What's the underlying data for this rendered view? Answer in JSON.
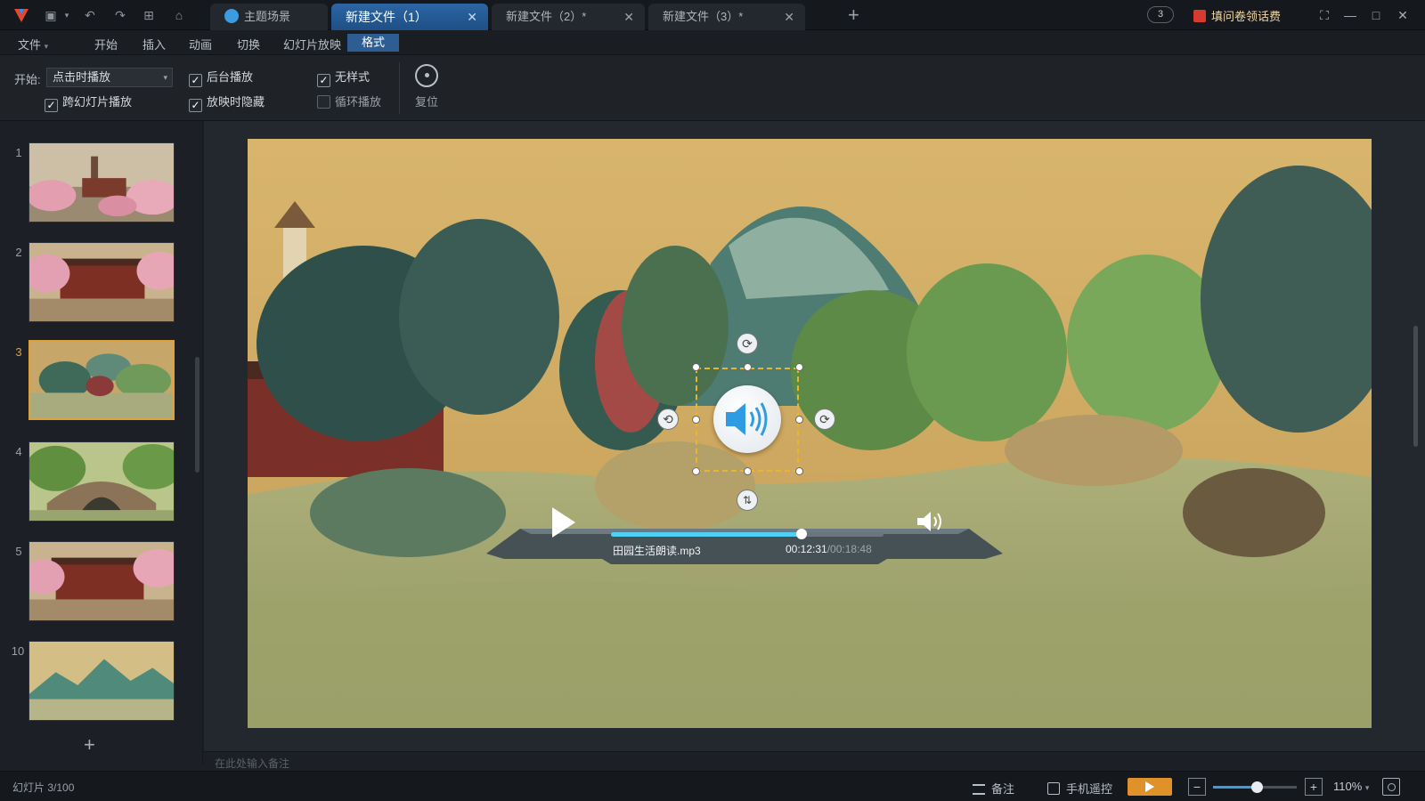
{
  "titlebar": {
    "tabs": [
      {
        "label": "主题场景",
        "active": false
      },
      {
        "label": "新建文件（1）",
        "active": true
      },
      {
        "label": "新建文件（2）*",
        "active": false
      },
      {
        "label": "新建文件（3）*",
        "active": false
      }
    ],
    "notification_count": "3",
    "promo_text": "填问卷领话费"
  },
  "menu": {
    "file": "文件",
    "items": [
      "开始",
      "插入",
      "动画",
      "切换",
      "幻灯片放映",
      "格式"
    ],
    "active_item": "格式"
  },
  "ribbon": {
    "start_label": "开始:",
    "start_select_value": "点击时播放",
    "checkboxes": [
      {
        "label": "跨幻灯片播放",
        "checked": true
      },
      {
        "label": "后台播放",
        "checked": true
      },
      {
        "label": "放映时隐藏",
        "checked": true
      },
      {
        "label": "无样式",
        "checked": true
      },
      {
        "label": "循环播放",
        "checked": false
      }
    ],
    "reset_label": "复位"
  },
  "slides": {
    "numbers": [
      "1",
      "2",
      "3",
      "4",
      "5",
      "10"
    ],
    "active_number": "3"
  },
  "audio_player": {
    "filename": "田园生活朗读.mp3",
    "current_time": "00:12:31",
    "total_time": "/00:18:48",
    "progress": 0.7
  },
  "notes": {
    "placeholder": "在此处输入备注"
  },
  "statusbar": {
    "slide_info": "幻灯片 3/100",
    "notes_label": "备注",
    "remote_label": "手机遥控",
    "zoom": "110%",
    "zoom_fraction": 0.52
  },
  "colors": {
    "accent": "#2b66a4",
    "highlight": "#e0a13b",
    "play": "#e0922a"
  }
}
